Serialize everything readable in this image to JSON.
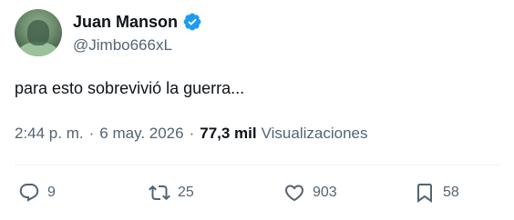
{
  "author": {
    "display_name": "Juan Manson",
    "handle": "@Jimbo666xL",
    "verified": true
  },
  "tweet": {
    "text": "para esto sobrevivió la guerra...",
    "time": "2:44 p. m.",
    "separator": "·",
    "date": "6 may. 2026",
    "views_count": "77,3 mil",
    "views_label": "Visualizaciones"
  },
  "actions": {
    "replies": "9",
    "retweets": "25",
    "likes": "903",
    "bookmarks": "58"
  },
  "colors": {
    "verified_badge": "#1d9bf0",
    "secondary_text": "#536471",
    "primary_text": "#0f1419"
  }
}
